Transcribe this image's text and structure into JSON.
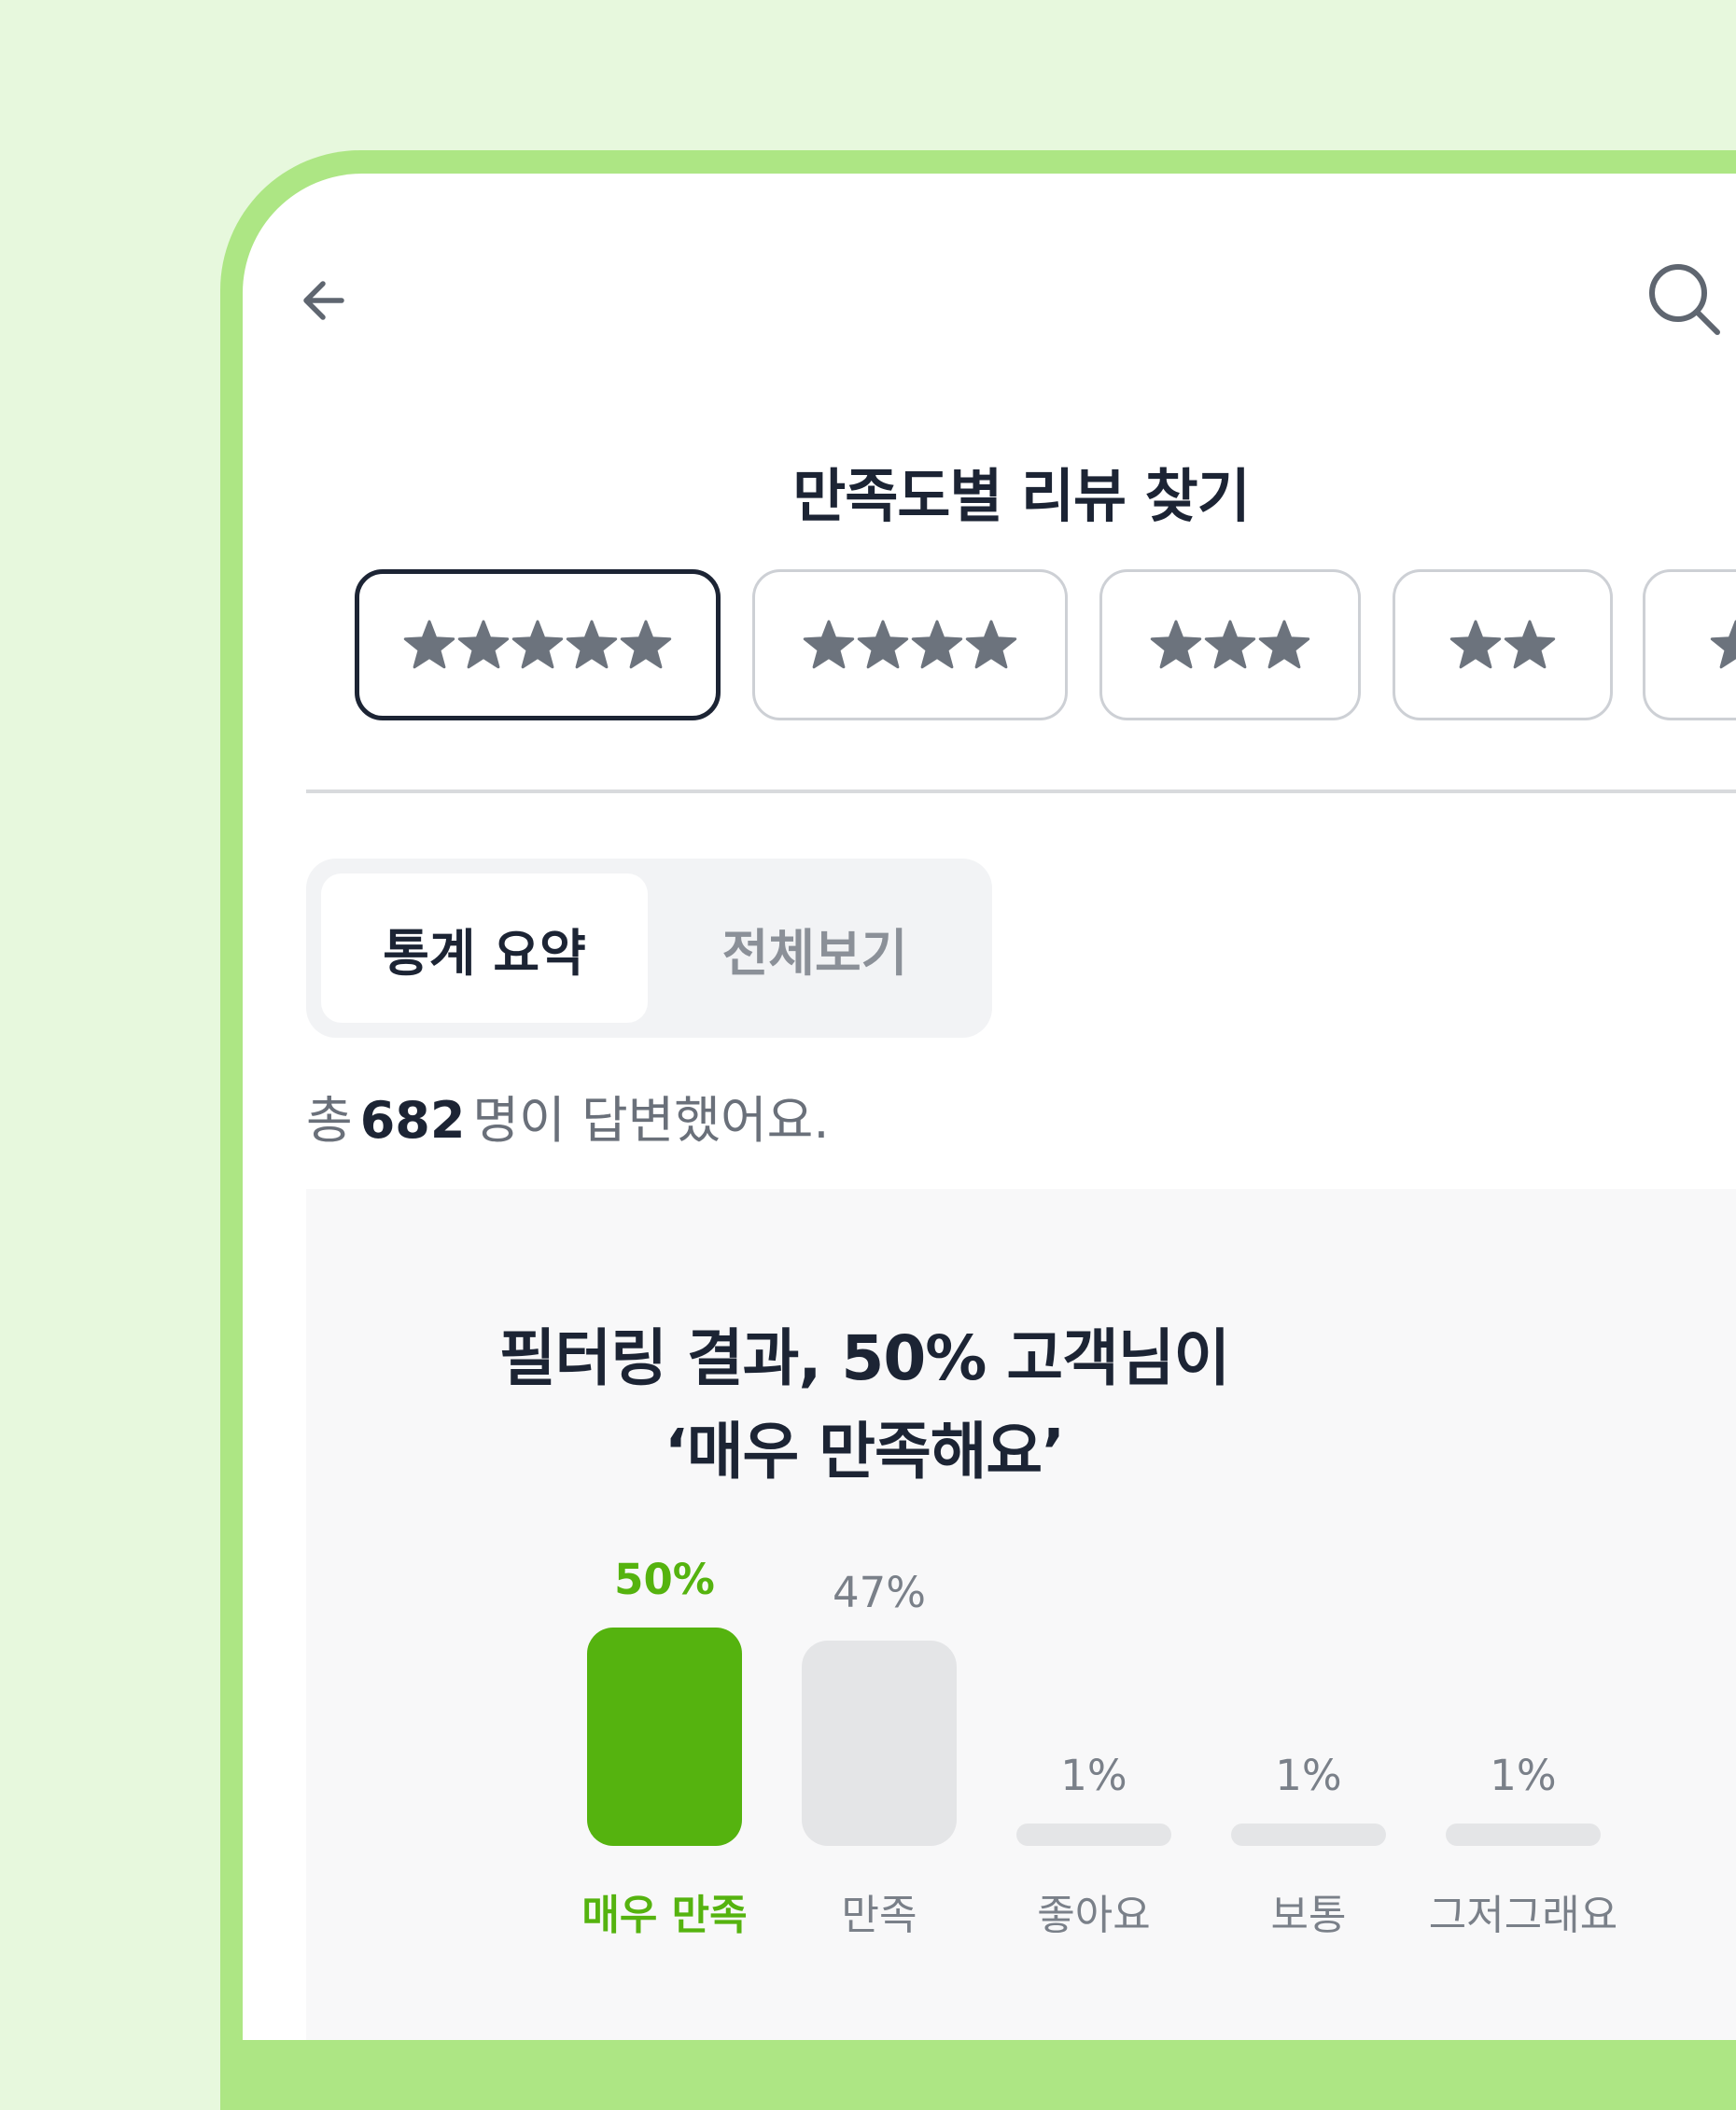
{
  "header": {
    "back_icon": "arrow-left-icon",
    "search_icon": "search-icon"
  },
  "section_title": "만족도별 리뷰 찾기",
  "rating_filters": [
    {
      "stars": 5,
      "selected": true
    },
    {
      "stars": 4,
      "selected": false
    },
    {
      "stars": 3,
      "selected": false
    },
    {
      "stars": 2,
      "selected": false
    },
    {
      "stars": 1,
      "selected": false
    }
  ],
  "tabs": [
    {
      "label": "통계 요약",
      "active": true
    },
    {
      "label": "전체보기",
      "active": false
    }
  ],
  "summary": {
    "prefix": "총",
    "count": "682",
    "suffix": "명이 답변했어요."
  },
  "result": {
    "line1": "필터링 결과, 50% 고객님이",
    "line2": "‘매우 만족해요’"
  },
  "colors": {
    "accent": "#55b30f",
    "frame": "#ade684",
    "background": "#e7f8dd",
    "text_primary": "#1c2434",
    "text_secondary": "#7a8089",
    "bar_inactive": "#e4e5e7"
  },
  "chart_data": {
    "type": "bar",
    "categories": [
      "매우 만족",
      "만족",
      "좋아요",
      "보통",
      "그저그래요"
    ],
    "values": [
      50,
      47,
      1,
      1,
      1
    ],
    "value_labels": [
      "50%",
      "47%",
      "1%",
      "1%",
      "1%"
    ],
    "highlight_index": 0,
    "unit": "%"
  }
}
